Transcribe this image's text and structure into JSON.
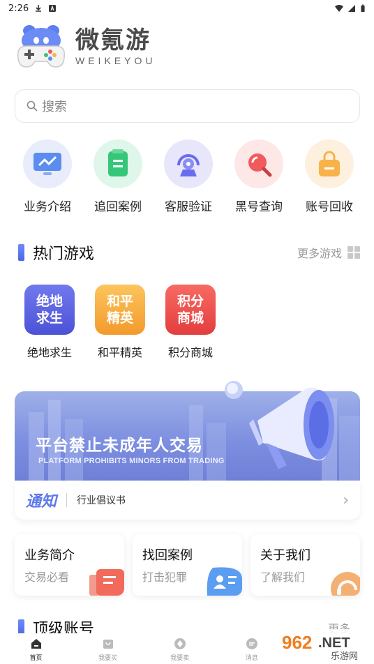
{
  "status_bar": {
    "time": "2:26"
  },
  "logo": {
    "title": "微氪游",
    "subtitle": "WEIKEYOU"
  },
  "search": {
    "placeholder": "搜索"
  },
  "quick_actions": [
    {
      "label": "业务介绍",
      "icon": "monitor-icon",
      "bg": "#e8ecfb",
      "color": "#5b8cf0"
    },
    {
      "label": "追回案例",
      "icon": "document-icon",
      "bg": "#dff6ea",
      "color": "#33c777"
    },
    {
      "label": "客服验证",
      "icon": "support-icon",
      "bg": "#e8e6fa",
      "color": "#6a6cf0"
    },
    {
      "label": "黑号查询",
      "icon": "search-icon",
      "bg": "#fde7e7",
      "color": "#f05b5b"
    },
    {
      "label": "账号回收",
      "icon": "bag-icon",
      "bg": "#fdf0df",
      "color": "#f7b24a"
    }
  ],
  "hot_games": {
    "title": "热门游戏",
    "more": "更多游戏",
    "items": [
      {
        "tile_text": "绝地\n求生",
        "name": "绝地求生",
        "bg": "#5a5fe0"
      },
      {
        "tile_text": "和平\n精英",
        "name": "和平精英",
        "bg": "#f7a93a"
      },
      {
        "tile_text": "积分\n商城",
        "name": "积分商城",
        "bg": "#f04a4a"
      }
    ]
  },
  "banner": {
    "title": "平台禁止未成年人交易",
    "subtitle": "PLATFORM PROHIBITS MINORS FROM TRADING",
    "notice_badge": "通知",
    "notice_text": "行业倡议书"
  },
  "info_cards": [
    {
      "title": "业务简介",
      "sub": "交易必看",
      "icon": "list-icon",
      "color": "#f26a5b"
    },
    {
      "title": "找回案例",
      "sub": "打击犯罪",
      "icon": "contacts-icon",
      "color": "#5b9df0"
    },
    {
      "title": "关于我们",
      "sub": "了解我们",
      "icon": "headset-icon",
      "color": "#f2a25b"
    }
  ],
  "top_accounts": {
    "title": "顶级账号",
    "more": "更多"
  },
  "tabbar": [
    {
      "label": "首页",
      "icon": "home-icon",
      "active": true
    },
    {
      "label": "我要买",
      "icon": "cart-icon",
      "active": false
    },
    {
      "label": "我要卖",
      "icon": "sell-icon",
      "active": false
    },
    {
      "label": "消息",
      "icon": "message-icon",
      "active": false
    }
  ],
  "watermark": {
    "text": "962.NET",
    "sub": "乐游网"
  }
}
